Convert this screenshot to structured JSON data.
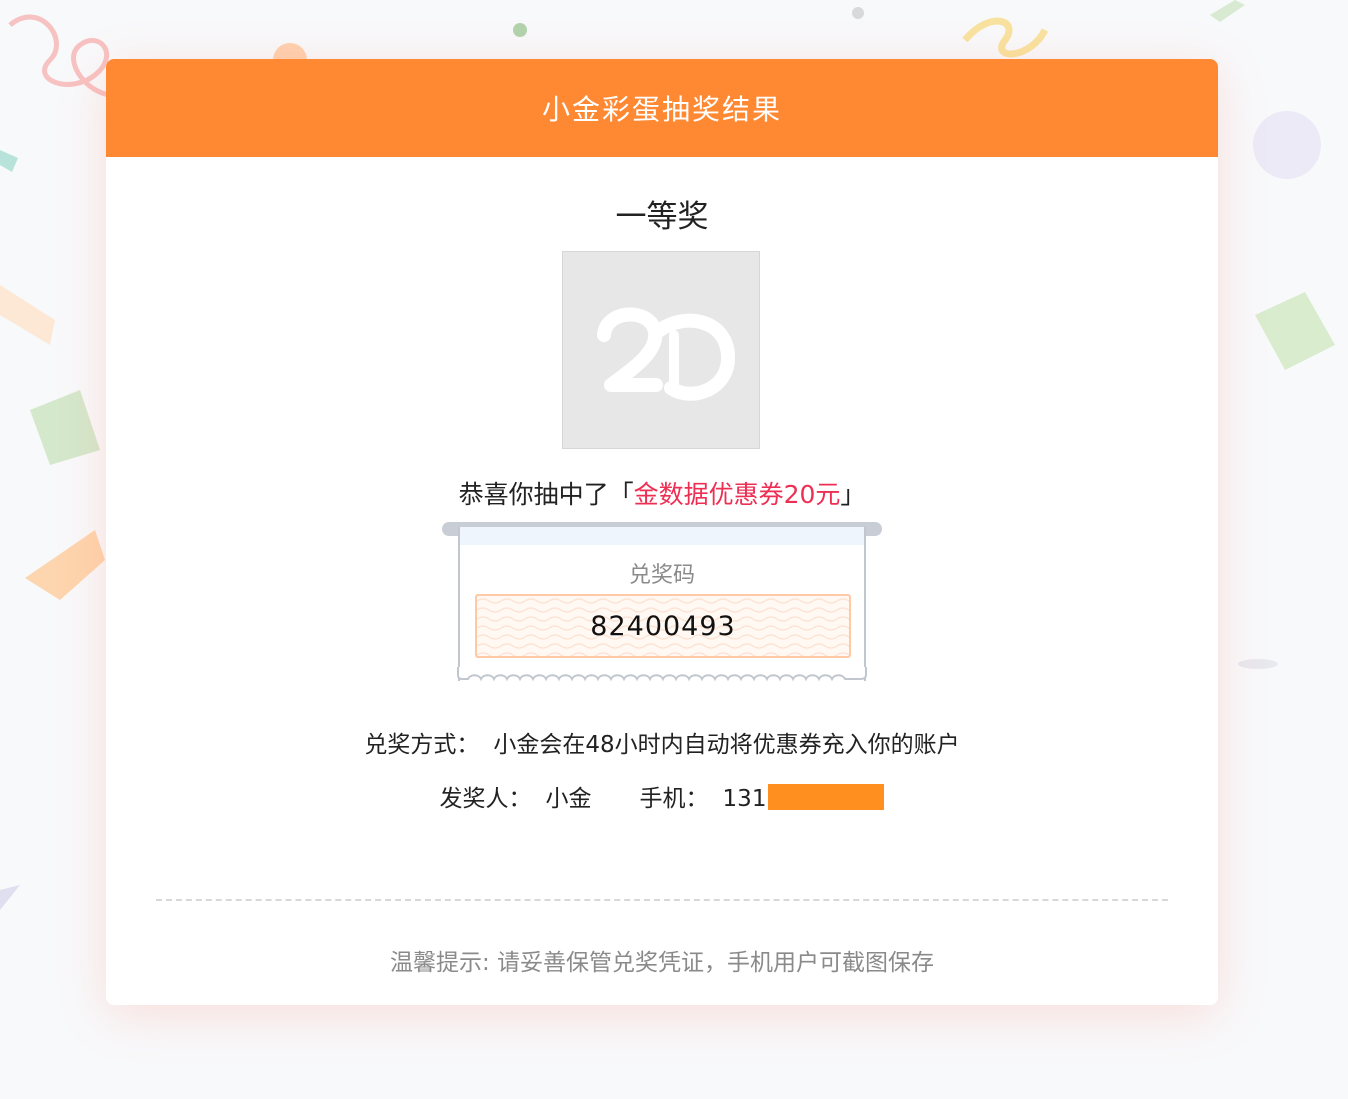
{
  "header": {
    "title": "小金彩蛋抽奖结果"
  },
  "prize": {
    "level": "一等奖",
    "image_icon": "prize-placeholder-logo-icon",
    "congrats_prefix": "恭喜你抽中了「",
    "prize_name": "金数据优惠券20元",
    "congrats_suffix": "」"
  },
  "ticket": {
    "label": "兑奖码",
    "code": "82400493"
  },
  "info": {
    "method_label": "兑奖方式：",
    "method_value": "小金会在48小时内自动将优惠券充入你的账户",
    "issuer_label": "发奖人：",
    "issuer_value": "小金",
    "phone_label": "手机：",
    "phone_prefix": "131"
  },
  "footer": {
    "tip": "温馨提示: 请妥善保管兑奖凭证，手机用户可截图保存"
  },
  "colors": {
    "header": "#ff8832",
    "highlight": "#ee2f54",
    "code_border": "#ffc9a6",
    "redaction": "#ff8f1f"
  }
}
